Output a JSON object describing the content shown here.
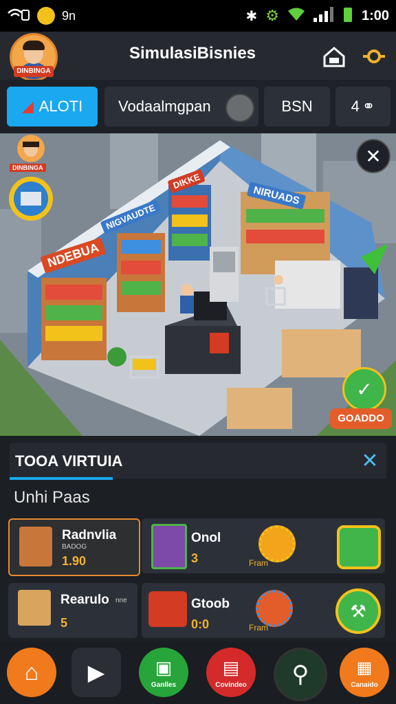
{
  "status": {
    "carrier": "9n",
    "time": "1:00"
  },
  "header": {
    "title": "SimulasiBisnies",
    "avatar_tag": "DINBINGA"
  },
  "tabs": [
    {
      "label": "ALOTI"
    },
    {
      "label": "Vodaalmgpan"
    },
    {
      "label": "BSN"
    },
    {
      "label": "4"
    }
  ],
  "scene": {
    "avatar_tag": "DINBINGA",
    "signs": [
      "NDEBUA",
      "NIGVAUDTE",
      "DIKKE",
      "NIRUADS"
    ],
    "action_button": "GOADDO"
  },
  "panel": {
    "title": "TOOA VIRTUIA",
    "subtitle": "Unhi Paas",
    "items": [
      {
        "name": "Radnvlia",
        "sub": "BADOG",
        "value": "1.90"
      },
      {
        "name": "Onol",
        "sub": "",
        "value": "3",
        "extra": "Fram"
      },
      {
        "name": "Rearulo",
        "sub": "nne",
        "value": "5"
      },
      {
        "name": "Gtoob",
        "sub": "",
        "value": "0:0",
        "extra": "Fram"
      }
    ]
  },
  "nav": [
    {
      "label": "",
      "icon": "home-icon",
      "color": "#f07a1c"
    },
    {
      "label": "",
      "icon": "play-icon",
      "color": "#2b2f35"
    },
    {
      "label": "Ganlles",
      "icon": "camera-icon",
      "color": "#27a53a"
    },
    {
      "label": "Covindeo",
      "icon": "gift-icon",
      "color": "#d42a2a"
    },
    {
      "label": "",
      "icon": "search-icon",
      "color": "#1f3a2b"
    },
    {
      "label": "Canaido",
      "icon": "image-icon",
      "color": "#f07a1c"
    }
  ]
}
